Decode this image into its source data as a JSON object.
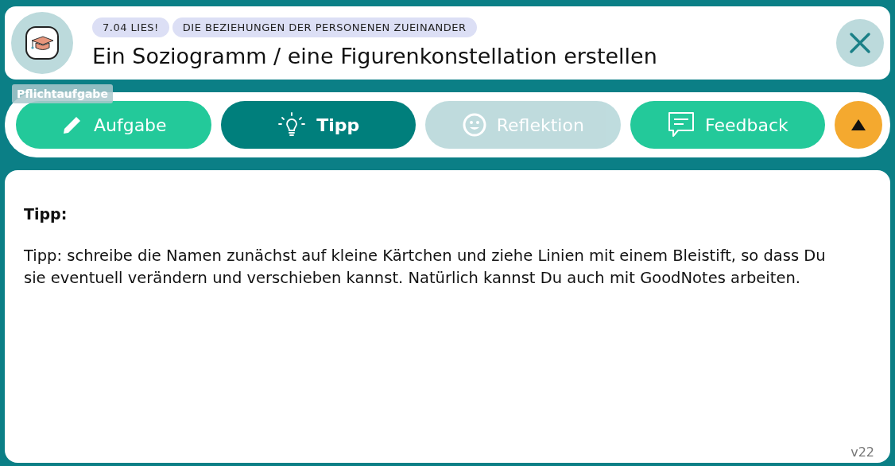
{
  "header": {
    "tags": [
      "7.04 LIES!",
      "DIE BEZIEHUNGEN DER PERSONENEN ZUEINANDER"
    ],
    "title": "Ein Soziogramm / eine Figurenkonstellation erstellen"
  },
  "badge": "Pflichtaufgabe",
  "tabs": [
    {
      "label": "Aufgabe",
      "kind": "pencil",
      "selected": false,
      "disabled": false
    },
    {
      "label": "Tipp",
      "kind": "bulb",
      "selected": true,
      "disabled": false
    },
    {
      "label": "Reflektion",
      "kind": "smiley",
      "selected": false,
      "disabled": true
    },
    {
      "label": "Feedback",
      "kind": "speech",
      "selected": false,
      "disabled": false
    }
  ],
  "content": {
    "heading": "Tipp:",
    "text": "Tipp: schreibe die Namen zunächst auf kleine Kärtchen und ziehe Linien mit einem Bleistift, so dass Du sie eventuell verändern und verschieben kannst. Natürlich kannst Du auch mit GoodNotes arbeiten."
  },
  "version": "v22"
}
